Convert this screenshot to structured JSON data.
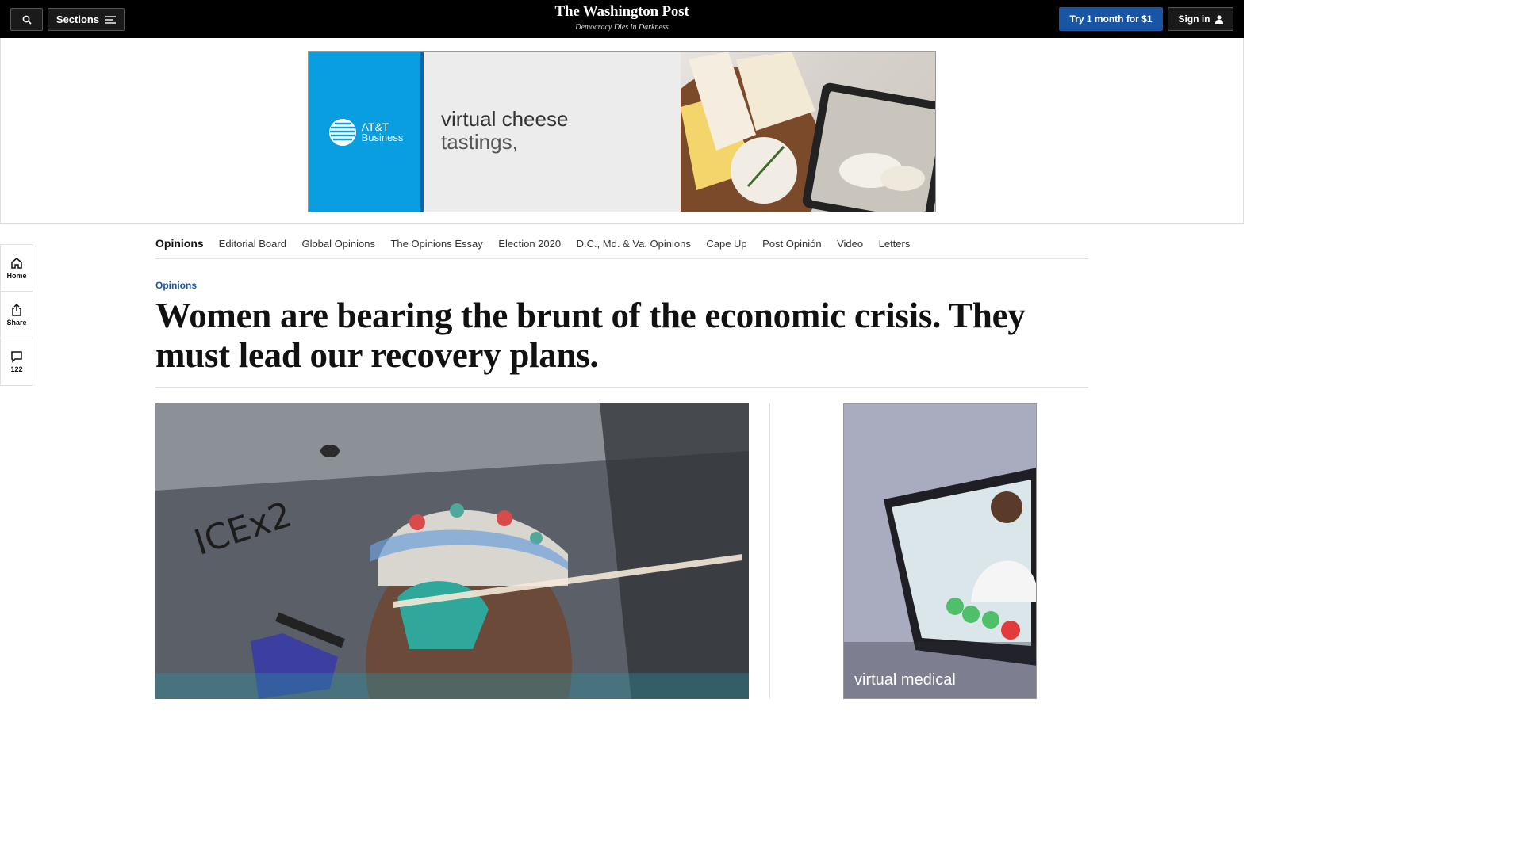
{
  "header": {
    "search_icon": "search-icon",
    "sections_label": "Sections",
    "logo": "The Washington Post",
    "tagline": "Democracy Dies in Darkness",
    "subscribe_label": "Try 1 month for $1",
    "signin_label": "Sign in"
  },
  "top_ad": {
    "brand_line1": "AT&T",
    "brand_line2": "Business",
    "headline_line1": "virtual cheese",
    "headline_line2": "tastings,"
  },
  "nav": {
    "items": [
      {
        "label": "Opinions"
      },
      {
        "label": "Editorial Board"
      },
      {
        "label": "Global Opinions"
      },
      {
        "label": "The Opinions Essay"
      },
      {
        "label": "Election 2020"
      },
      {
        "label": "D.C., Md. & Va. Opinions"
      },
      {
        "label": "Cape Up"
      },
      {
        "label": "Post Opinión"
      },
      {
        "label": "Video"
      },
      {
        "label": "Letters"
      }
    ]
  },
  "rail": {
    "home_label": "Home",
    "share_label": "Share",
    "comments_count": "122"
  },
  "article": {
    "kicker": "Opinions",
    "headline": "Women are bearing the brunt of the economic crisis. They must lead our recovery plans."
  },
  "side_ad": {
    "text": "virtual medical"
  },
  "colors": {
    "topbar": "#000000",
    "accent_blue": "#1955a5",
    "att_blue": "#099ee0"
  }
}
